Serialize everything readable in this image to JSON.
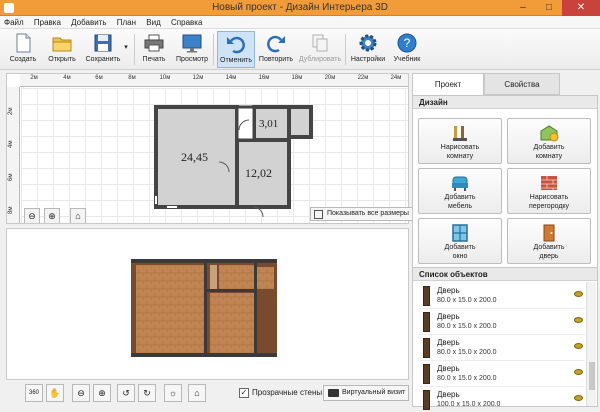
{
  "window": {
    "title": "Новый проект - Дизайн Интерьера 3D",
    "minimize": "–",
    "maximize": "□",
    "close": "✕"
  },
  "menu": [
    "Файл",
    "Правка",
    "Добавить",
    "План",
    "Вид",
    "Справка"
  ],
  "toolbar": {
    "create": "Создать",
    "open": "Открыть",
    "save": "Сохранить",
    "print": "Печать",
    "preview": "Просмотр",
    "undo": "Отменить",
    "redo": "Повторить",
    "duplicate": "Дублировать",
    "settings": "Настройки",
    "tutorial": "Учебник"
  },
  "plan": {
    "hruler": [
      "2м",
      "4м",
      "6м",
      "8м",
      "10м",
      "12м",
      "14м",
      "16м",
      "18м",
      "20м",
      "22м",
      "24м"
    ],
    "vruler": [
      "2м",
      "4м",
      "6м",
      "8м"
    ],
    "rooms": [
      "24,45",
      "3,01",
      "12,02"
    ],
    "show_all_sizes": "Показывать все размеры"
  },
  "bottom": {
    "transparent_walls": "Прозрачные стены",
    "virtual_visit": "Виртуальный визит",
    "rotate_label": "360"
  },
  "panel": {
    "tabs": [
      "Проект",
      "Свойства"
    ],
    "design_header": "Дизайн",
    "buttons": [
      {
        "line1": "Нарисовать",
        "line2": "комнату"
      },
      {
        "line1": "Добавить",
        "line2": "комнату"
      },
      {
        "line1": "Добавить",
        "line2": "мебель"
      },
      {
        "line1": "Нарисовать",
        "line2": "перегородку"
      },
      {
        "line1": "Добавить",
        "line2": "окно"
      },
      {
        "line1": "Добавить",
        "line2": "дверь"
      }
    ],
    "objects_header": "Список объектов",
    "objects": [
      {
        "name": "Дверь",
        "size": "80.0 x 15.0 x 200.0"
      },
      {
        "name": "Дверь",
        "size": "80.0 x 15.0 x 200.0"
      },
      {
        "name": "Дверь",
        "size": "80.0 x 15.0 x 200.0"
      },
      {
        "name": "Дверь",
        "size": "80.0 x 15.0 x 200.0"
      },
      {
        "name": "Дверь",
        "size": "100.0 x 15.0 x 200.0"
      }
    ]
  }
}
